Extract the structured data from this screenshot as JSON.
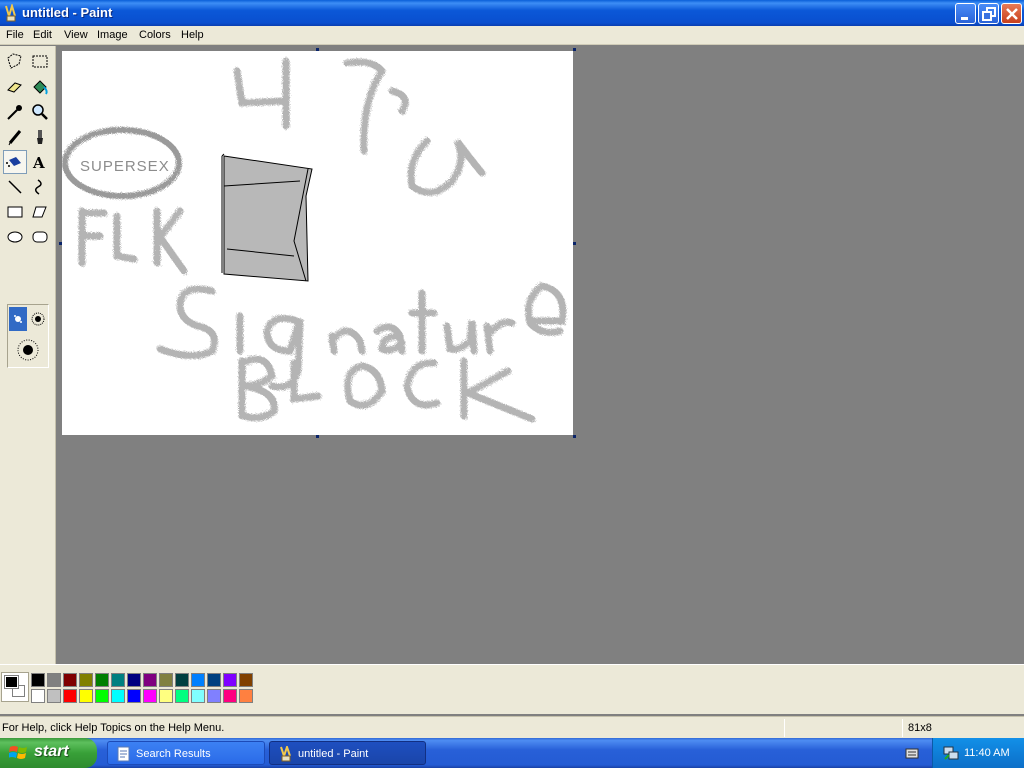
{
  "window": {
    "title": "untitled - Paint"
  },
  "menu": [
    "File",
    "Edit",
    "View",
    "Image",
    "Colors",
    "Help"
  ],
  "tools": [
    {
      "name": "free-form-select"
    },
    {
      "name": "select"
    },
    {
      "name": "eraser"
    },
    {
      "name": "fill-with-color"
    },
    {
      "name": "pick-color"
    },
    {
      "name": "magnifier"
    },
    {
      "name": "pencil"
    },
    {
      "name": "brush"
    },
    {
      "name": "airbrush",
      "active": true
    },
    {
      "name": "text"
    },
    {
      "name": "line"
    },
    {
      "name": "curve"
    },
    {
      "name": "rectangle"
    },
    {
      "name": "polygon"
    },
    {
      "name": "ellipse"
    },
    {
      "name": "rounded-rectangle"
    }
  ],
  "canvas": {
    "drawing_text": "SUPERSEX"
  },
  "palette": {
    "foreground": "#000000",
    "background": "#ffffff",
    "top_row": [
      "#000000",
      "#808080",
      "#800000",
      "#808000",
      "#008000",
      "#008080",
      "#000080",
      "#800080",
      "#808040",
      "#004040",
      "#0080ff",
      "#004080",
      "#8000ff",
      "#804000"
    ],
    "bottom_row": [
      "#ffffff",
      "#c0c0c0",
      "#ff0000",
      "#ffff00",
      "#00ff00",
      "#00ffff",
      "#0000ff",
      "#ff00ff",
      "#ffff80",
      "#00ff80",
      "#80ffff",
      "#8080ff",
      "#ff0080",
      "#ff8040"
    ]
  },
  "status": {
    "help_text": "For Help, click Help Topics on the Help Menu.",
    "coords": "81x8"
  },
  "taskbar": {
    "start_label": "start",
    "buttons": [
      {
        "label": "Search Results",
        "active": false
      },
      {
        "label": "untitled - Paint",
        "active": true
      }
    ],
    "clock": "11:40 AM"
  }
}
